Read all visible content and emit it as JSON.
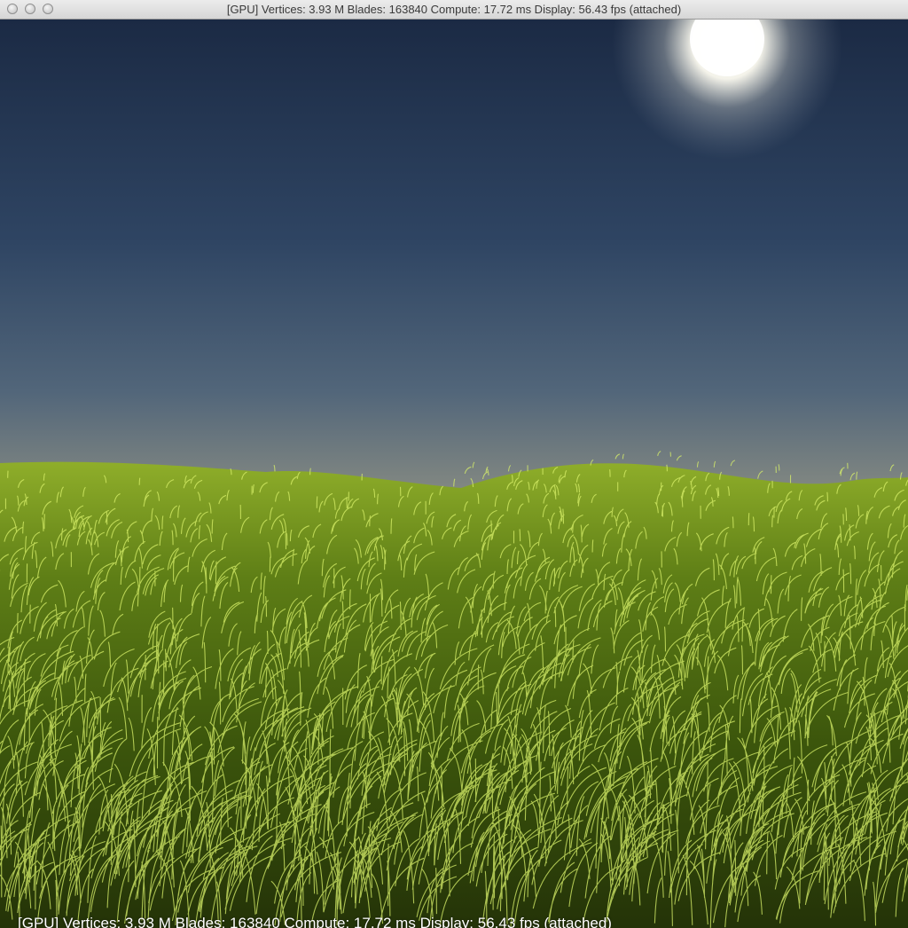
{
  "window": {
    "title": "[GPU] Vertices: 3.93 M  Blades: 163840  Compute: 17.72 ms  Display: 56.43 fps (attached)"
  },
  "hud": {
    "stats_text": "[GPU] Vertices: 3.93 M  Blades: 163840  Compute: 17.72 ms  Display: 56.43 fps (attached)"
  },
  "scene": {
    "sky_top_color": "#1b2a44",
    "sky_horizon_color": "#8f9184",
    "grass_dark_color": "#243308",
    "grass_light_color": "#d8f06a",
    "sun_color": "#ffffff"
  }
}
